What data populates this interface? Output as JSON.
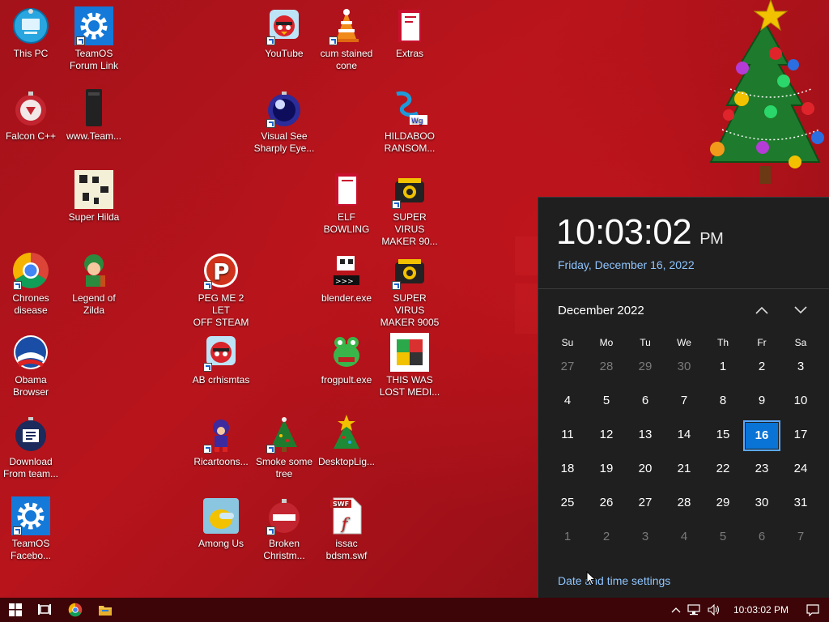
{
  "desktop_icons": [
    {
      "label1": "This PC",
      "label2": ""
    },
    {
      "label1": "TeamOS",
      "label2": "Forum Link"
    },
    {
      "label1": "YouTube",
      "label2": ""
    },
    {
      "label1": "cum stained",
      "label2": "cone"
    },
    {
      "label1": "Extras",
      "label2": ""
    },
    {
      "label1": "Falcon C++",
      "label2": ""
    },
    {
      "label1": "www.Team...",
      "label2": ""
    },
    {
      "label1": "Visual See",
      "label2": "Sharply Eye..."
    },
    {
      "label1": "HILDABOO",
      "label2": "RANSOM..."
    },
    {
      "label1": "Super Hilda",
      "label2": ""
    },
    {
      "label1": "ELF BOWLING",
      "label2": ""
    },
    {
      "label1": "SUPER VIRUS",
      "label2": "MAKER 90..."
    },
    {
      "label1": "Chrones",
      "label2": "disease"
    },
    {
      "label1": "Legend of",
      "label2": "Zilda"
    },
    {
      "label1": "PEG ME 2 LET",
      "label2": "OFF STEAM"
    },
    {
      "label1": "blender.exe",
      "label2": ""
    },
    {
      "label1": "SUPER VIRUS",
      "label2": "MAKER 9005"
    },
    {
      "label1": "Obama",
      "label2": "Browser"
    },
    {
      "label1": "AB crhismtas",
      "label2": ""
    },
    {
      "label1": "frogpult.exe",
      "label2": ""
    },
    {
      "label1": "THIS WAS",
      "label2": "LOST MEDI..."
    },
    {
      "label1": "Download",
      "label2": "From team..."
    },
    {
      "label1": "Ricartoons...",
      "label2": ""
    },
    {
      "label1": "Smoke some",
      "label2": "tree"
    },
    {
      "label1": "DesktopLig...",
      "label2": ""
    },
    {
      "label1": "TeamOS",
      "label2": "Facebo..."
    },
    {
      "label1": "Among Us",
      "label2": ""
    },
    {
      "label1": "Broken",
      "label2": "Christm..."
    },
    {
      "label1": "issac",
      "label2": "bdsm.swf"
    }
  ],
  "calendar": {
    "time": "10:03:02",
    "ampm": "PM",
    "full_date": "Friday, December 16, 2022",
    "month_label": "December 2022",
    "weekdays": [
      "Su",
      "Mo",
      "Tu",
      "We",
      "Th",
      "Fr",
      "Sa"
    ],
    "days": [
      {
        "d": "27",
        "dim": true
      },
      {
        "d": "28",
        "dim": true
      },
      {
        "d": "29",
        "dim": true
      },
      {
        "d": "30",
        "dim": true
      },
      {
        "d": "1"
      },
      {
        "d": "2"
      },
      {
        "d": "3"
      },
      {
        "d": "4"
      },
      {
        "d": "5"
      },
      {
        "d": "6"
      },
      {
        "d": "7"
      },
      {
        "d": "8"
      },
      {
        "d": "9"
      },
      {
        "d": "10"
      },
      {
        "d": "11"
      },
      {
        "d": "12"
      },
      {
        "d": "13"
      },
      {
        "d": "14"
      },
      {
        "d": "15"
      },
      {
        "d": "16",
        "today": true
      },
      {
        "d": "17"
      },
      {
        "d": "18"
      },
      {
        "d": "19"
      },
      {
        "d": "20"
      },
      {
        "d": "21"
      },
      {
        "d": "22"
      },
      {
        "d": "23"
      },
      {
        "d": "24"
      },
      {
        "d": "25"
      },
      {
        "d": "26"
      },
      {
        "d": "27"
      },
      {
        "d": "28"
      },
      {
        "d": "29"
      },
      {
        "d": "30"
      },
      {
        "d": "31"
      },
      {
        "d": "1",
        "dim": true
      },
      {
        "d": "2",
        "dim": true
      },
      {
        "d": "3",
        "dim": true
      },
      {
        "d": "4",
        "dim": true
      },
      {
        "d": "5",
        "dim": true
      },
      {
        "d": "6",
        "dim": true
      },
      {
        "d": "7",
        "dim": true
      }
    ],
    "settings_link": "Date and time settings"
  },
  "taskbar": {
    "clock": "10:03:02 PM",
    "icons": [
      "windows-start-icon",
      "task-view-icon",
      "chrome-icon",
      "file-explorer-icon"
    ]
  },
  "colors": {
    "accent": "#0a73d6",
    "link": "#8fc5ff",
    "flyout_bg": "#1f1f1f",
    "taskbar_bg": "#3d0508"
  }
}
